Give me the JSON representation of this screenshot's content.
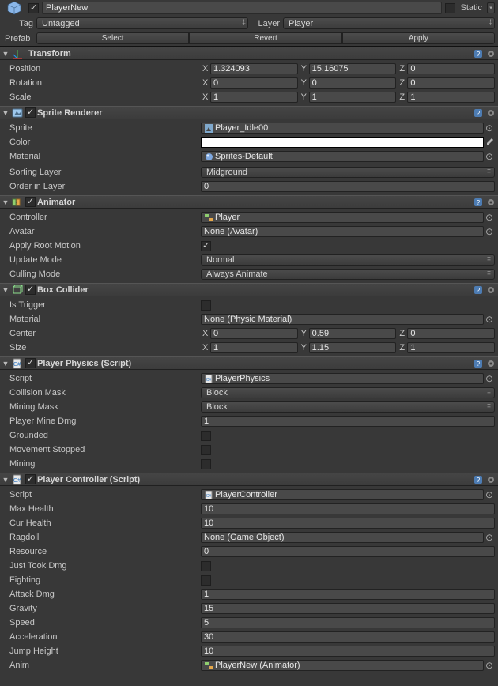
{
  "header": {
    "name": "PlayerNew",
    "static_label": "Static",
    "tag_label": "Tag",
    "tag_value": "Untagged",
    "layer_label": "Layer",
    "layer_value": "Player",
    "prefab_label": "Prefab",
    "select": "Select",
    "revert": "Revert",
    "apply": "Apply"
  },
  "transform": {
    "title": "Transform",
    "position": {
      "label": "Position",
      "x": "1.324093",
      "y": "15.16075",
      "z": "0"
    },
    "rotation": {
      "label": "Rotation",
      "x": "0",
      "y": "0",
      "z": "0"
    },
    "scale": {
      "label": "Scale",
      "x": "1",
      "y": "1",
      "z": "1"
    }
  },
  "spriteRenderer": {
    "title": "Sprite Renderer",
    "sprite_label": "Sprite",
    "sprite_value": "Player_Idle00",
    "color_label": "Color",
    "color_value": "#FFFFFF",
    "material_label": "Material",
    "material_value": "Sprites-Default",
    "sortingLayer_label": "Sorting Layer",
    "sortingLayer_value": "Midground",
    "orderInLayer_label": "Order in Layer",
    "orderInLayer_value": "0"
  },
  "animator": {
    "title": "Animator",
    "controller_label": "Controller",
    "controller_value": "Player",
    "avatar_label": "Avatar",
    "avatar_value": "None (Avatar)",
    "applyRootMotion_label": "Apply Root Motion",
    "updateMode_label": "Update Mode",
    "updateMode_value": "Normal",
    "cullingMode_label": "Culling Mode",
    "cullingMode_value": "Always Animate"
  },
  "boxCollider": {
    "title": "Box Collider",
    "isTrigger_label": "Is Trigger",
    "material_label": "Material",
    "material_value": "None (Physic Material)",
    "center_label": "Center",
    "center": {
      "x": "0",
      "y": "0.59",
      "z": "0"
    },
    "size_label": "Size",
    "size": {
      "x": "1",
      "y": "1.15",
      "z": "1"
    }
  },
  "playerPhysics": {
    "title": "Player Physics (Script)",
    "script_label": "Script",
    "script_value": "PlayerPhysics",
    "collisionMask_label": "Collision Mask",
    "collisionMask_value": "Block",
    "miningMask_label": "Mining Mask",
    "miningMask_value": "Block",
    "playerMineDmg_label": "Player Mine Dmg",
    "playerMineDmg_value": "1",
    "grounded_label": "Grounded",
    "movementStopped_label": "Movement Stopped",
    "mining_label": "Mining"
  },
  "playerController": {
    "title": "Player Controller (Script)",
    "script_label": "Script",
    "script_value": "PlayerController",
    "maxHealth_label": "Max Health",
    "maxHealth_value": "10",
    "curHealth_label": "Cur Health",
    "curHealth_value": "10",
    "ragdoll_label": "Ragdoll",
    "ragdoll_value": "None (Game Object)",
    "resource_label": "Resource",
    "resource_value": "0",
    "justTookDmg_label": "Just Took Dmg",
    "fighting_label": "Fighting",
    "attackDmg_label": "Attack Dmg",
    "attackDmg_value": "1",
    "gravity_label": "Gravity",
    "gravity_value": "15",
    "speed_label": "Speed",
    "speed_value": "5",
    "acceleration_label": "Acceleration",
    "acceleration_value": "30",
    "jumpHeight_label": "Jump Height",
    "jumpHeight_value": "10",
    "anim_label": "Anim",
    "anim_value": "PlayerNew (Animator)"
  },
  "axis": {
    "x": "X",
    "y": "Y",
    "z": "Z"
  }
}
